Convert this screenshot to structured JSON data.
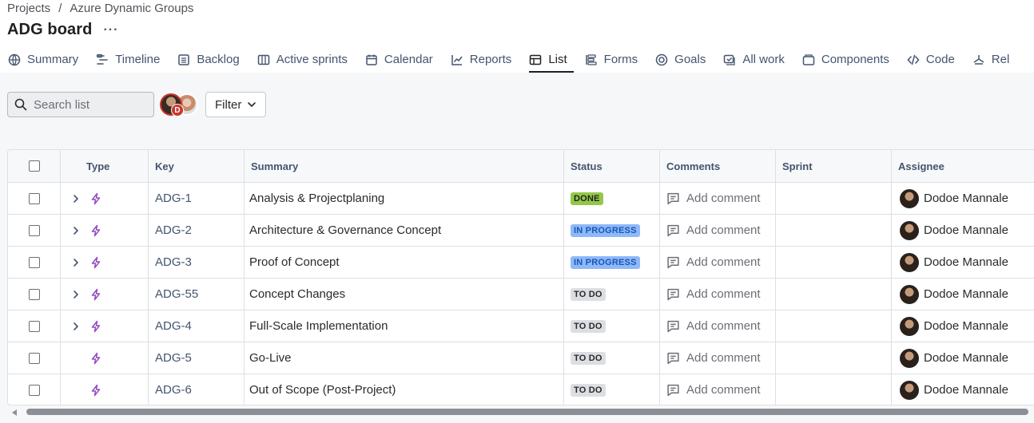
{
  "breadcrumb": {
    "projects": "Projects",
    "separator": "/",
    "project": "Azure Dynamic Groups"
  },
  "board": {
    "title": "ADG board",
    "more": "···"
  },
  "tabs": [
    {
      "label": "Summary",
      "icon": "globe-icon"
    },
    {
      "label": "Timeline",
      "icon": "timeline-icon"
    },
    {
      "label": "Backlog",
      "icon": "backlog-icon"
    },
    {
      "label": "Active sprints",
      "icon": "board-icon"
    },
    {
      "label": "Calendar",
      "icon": "calendar-icon"
    },
    {
      "label": "Reports",
      "icon": "chart-icon"
    },
    {
      "label": "List",
      "icon": "list-icon",
      "active": true
    },
    {
      "label": "Forms",
      "icon": "forms-icon"
    },
    {
      "label": "Goals",
      "icon": "goal-icon"
    },
    {
      "label": "All work",
      "icon": "all-work-icon"
    },
    {
      "label": "Components",
      "icon": "components-icon"
    },
    {
      "label": "Code",
      "icon": "code-icon"
    },
    {
      "label": "Rel",
      "icon": "releases-icon"
    }
  ],
  "toolbar": {
    "search_placeholder": "Search list",
    "avatar_badge": "D",
    "filter_label": "Filter"
  },
  "table": {
    "headers": {
      "type": "Type",
      "key": "Key",
      "summary": "Summary",
      "status": "Status",
      "comments": "Comments",
      "sprint": "Sprint",
      "assignee": "Assignee"
    },
    "rows": [
      {
        "key": "ADG-1",
        "summary": "Analysis & Projectplaning",
        "status": "DONE",
        "status_kind": "done",
        "comment": "Add comment",
        "sprint": "",
        "assignee": "Dodoe Mannale",
        "expandable": true
      },
      {
        "key": "ADG-2",
        "summary": "Architecture & Governance Concept",
        "status": "IN PROGRESS",
        "status_kind": "progress",
        "comment": "Add comment",
        "sprint": "",
        "assignee": "Dodoe Mannale",
        "expandable": true
      },
      {
        "key": "ADG-3",
        "summary": "Proof of Concept",
        "status": "IN PROGRESS",
        "status_kind": "progress",
        "comment": "Add comment",
        "sprint": "",
        "assignee": "Dodoe Mannale",
        "expandable": true
      },
      {
        "key": "ADG-55",
        "summary": "Concept Changes",
        "status": "TO DO",
        "status_kind": "todo",
        "comment": "Add comment",
        "sprint": "",
        "assignee": "Dodoe Mannale",
        "expandable": true
      },
      {
        "key": "ADG-4",
        "summary": "Full-Scale Implementation",
        "status": "TO DO",
        "status_kind": "todo",
        "comment": "Add comment",
        "sprint": "",
        "assignee": "Dodoe Mannale",
        "expandable": true
      },
      {
        "key": "ADG-5",
        "summary": "Go-Live",
        "status": "TO DO",
        "status_kind": "todo",
        "comment": "Add comment",
        "sprint": "",
        "assignee": "Dodoe Mannale",
        "expandable": false
      },
      {
        "key": "ADG-6",
        "summary": "Out of Scope (Post-Project)",
        "status": "TO DO",
        "status_kind": "todo",
        "comment": "Add comment",
        "sprint": "",
        "assignee": "Dodoe Mannale",
        "expandable": false
      }
    ]
  },
  "colors": {
    "done_bg": "#94c748",
    "done_fg": "#1f2024",
    "progress_bg": "#8fb8f6",
    "progress_fg": "#1558bc",
    "todo_bg": "#dddee1",
    "todo_fg": "#292a2e",
    "epic": "#964ac0"
  }
}
